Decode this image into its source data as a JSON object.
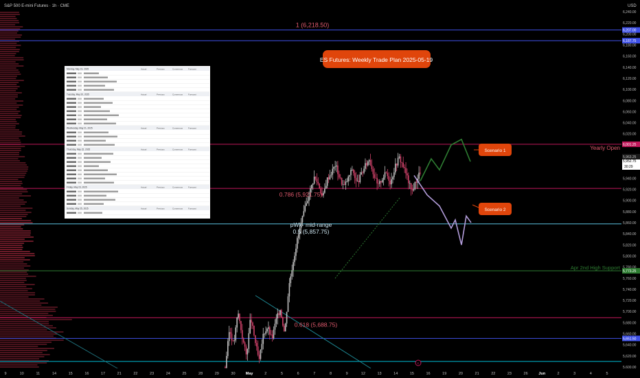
{
  "header": {
    "symbol": "S&P 500 E-mini Futures · 1h · CME",
    "currency": "USD"
  },
  "banner": {
    "text": "ES Futures: Weekly Trade Plan 2025-05-19",
    "color": "#e0450b"
  },
  "levels": [
    {
      "id": "fib-1",
      "label": "1 (6,218.50)",
      "price": 6207.0,
      "tag": "6,207.00",
      "color": "#3f51e6",
      "label_color": "#e05a6e"
    },
    {
      "id": "top-blue",
      "price": 6187.75,
      "tag": "6,187.75",
      "color": "#3f51e6"
    },
    {
      "id": "yearly-open",
      "label": "Yearly Open",
      "price": 6001.25,
      "tag": "6,001.25",
      "color": "#c2185b",
      "label_color": "#e05a6e"
    },
    {
      "id": "fib-0786",
      "label": "0.786 (5,921.75)",
      "price": 5921.75,
      "color": "#c2185b",
      "label_color": "#e05a6e"
    },
    {
      "id": "pwk-mid",
      "label": "pWk- mid-range",
      "label2": "0.5 (5,857.75)",
      "price": 5857.75,
      "color": "#5bc0de",
      "label_color": "#cfe8f3"
    },
    {
      "id": "apr-2nd-high",
      "label": "Apr 2nd High Support",
      "price": 5773.25,
      "tag": "5,773.25",
      "color": "#2e7d32",
      "label_color": "#2e7d32"
    },
    {
      "id": "fib-0618",
      "label": "0.618 (5,688.75)",
      "price": 5688.75,
      "color": "#c2185b",
      "label_color": "#e05a6e"
    },
    {
      "id": "blue-low",
      "price": 5651.5,
      "tag": "5,651.50",
      "color": "#3f51e6"
    },
    {
      "id": "cyan-low",
      "price": 5610.0,
      "color": "#00bcd4"
    }
  ],
  "price_tags": {
    "current": "5,952.75",
    "countdown": "30:29",
    "near": "5,963.25"
  },
  "y_axis": {
    "min": 5600,
    "max": 6240,
    "ticks": [
      "6,240.00",
      "6,220.00",
      "6,200.00",
      "6,180.00",
      "6,160.00",
      "6,140.00",
      "6,120.00",
      "6,100.00",
      "6,080.00",
      "6,060.00",
      "6,040.00",
      "6,020.00",
      "6,000.00",
      "5,980.00",
      "5,960.00",
      "5,940.00",
      "5,920.00",
      "5,900.00",
      "5,880.00",
      "5,860.00",
      "5,840.00",
      "5,820.00",
      "5,800.00",
      "5,780.00",
      "5,760.00",
      "5,740.00",
      "5,720.00",
      "5,700.00",
      "5,680.00",
      "5,660.00",
      "5,640.00",
      "5,620.00",
      "5,600.00"
    ]
  },
  "x_axis": {
    "labels": [
      "9",
      "10",
      "11",
      "14",
      "15",
      "16",
      "17",
      "21",
      "22",
      "23",
      "24",
      "25",
      "28",
      "29",
      "30",
      "May",
      "2",
      "5",
      "6",
      "7",
      "8",
      "9",
      "12",
      "13",
      "14",
      "15",
      "16",
      "19",
      "20",
      "21",
      "22",
      "23",
      "26",
      "Jun",
      "2",
      "3",
      "4",
      "5"
    ]
  },
  "scenarios": [
    {
      "label": "Scenario 1",
      "color": "#e0450b",
      "path_color": "#2e7d32"
    },
    {
      "label": "Scenario 2",
      "color": "#e0450b",
      "path_color": "#b39ddb"
    }
  ],
  "calendar": {
    "columns": [
      "Actual",
      "Previous",
      "Consensus",
      "Forecast"
    ],
    "days": [
      "Monday, May 19, 2025",
      "Tuesday, May 20, 2025",
      "Wednesday, May 21, 2025",
      "Thursday, May 22, 2025",
      "Friday, May 23, 2025",
      "Sunday, May 25, 2025"
    ]
  },
  "chart_data": {
    "type": "line",
    "title": "ES Futures: Weekly Trade Plan 2025-05-19",
    "xlabel": "",
    "ylabel": "",
    "ylim": [
      5600,
      6240
    ],
    "series": [
      {
        "values": [
          5600,
          5668,
          5640,
          5700,
          5655,
          5620,
          5690,
          5648,
          5610,
          5660,
          5672,
          5650,
          5685,
          5705,
          5660,
          5745,
          5790,
          5830,
          5862,
          5890,
          5918,
          5942,
          5930,
          5905,
          5938,
          5950,
          5965,
          5940,
          5925,
          5940,
          5958,
          5930,
          5945,
          5962,
          5975,
          5948,
          5925,
          5940,
          5950,
          5932,
          5960,
          5978,
          5962,
          5940,
          5915,
          5935,
          5952
        ]
      },
      {
        "values": [
          5935,
          5975,
          5955,
          6000,
          6010,
          5970
        ]
      },
      {
        "values": [
          5945,
          5910,
          5890,
          5850,
          5865,
          5820,
          5872,
          5860
        ]
      }
    ]
  }
}
